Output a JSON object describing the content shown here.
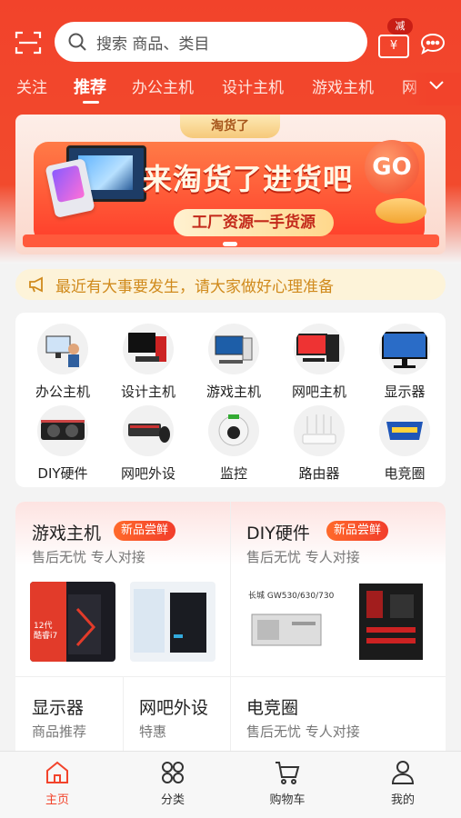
{
  "colors": {
    "brand": "#f2432b",
    "notice_text": "#d08a1c",
    "badge": "#f23d2b"
  },
  "search": {
    "placeholder": "搜索 商品、类目"
  },
  "header": {
    "coupon_badge": "减",
    "coupon_symbol": "¥"
  },
  "tabs": [
    {
      "label": "关注"
    },
    {
      "label": "推荐",
      "active": true
    },
    {
      "label": "办公主机"
    },
    {
      "label": "设计主机"
    },
    {
      "label": "游戏主机"
    },
    {
      "label": "网"
    }
  ],
  "banner": {
    "tag": "淘货了",
    "title": "来淘货了进货吧",
    "subtitle": "工厂资源一手货源",
    "go": "GO"
  },
  "notice": {
    "text": "最近有大事要发生，请大家做好心理准备"
  },
  "categories": [
    {
      "label": "办公主机",
      "icon": "office-pc-icon"
    },
    {
      "label": "设计主机",
      "icon": "design-pc-icon"
    },
    {
      "label": "游戏主机",
      "icon": "gaming-pc-icon"
    },
    {
      "label": "网吧主机",
      "icon": "netcafe-pc-icon"
    },
    {
      "label": "显示器",
      "icon": "monitor-icon"
    },
    {
      "label": "DIY硬件",
      "icon": "gpu-icon"
    },
    {
      "label": "网吧外设",
      "icon": "peripheral-icon"
    },
    {
      "label": "监控",
      "icon": "camera-icon"
    },
    {
      "label": "路由器",
      "icon": "router-icon"
    },
    {
      "label": "电竞圈",
      "icon": "esports-icon"
    }
  ],
  "sections": {
    "gaming": {
      "title": "游戏主机",
      "badge": "新品尝鲜",
      "sub": "售后无忧 专人对接"
    },
    "diy": {
      "title": "DIY硬件",
      "badge": "新品尝鲜",
      "sub": "售后无忧 专人对接"
    },
    "monitor": {
      "title": "显示器",
      "sub": "商品推荐"
    },
    "peripheral": {
      "title": "网吧外设",
      "sub": "特惠"
    },
    "esports": {
      "title": "电竞圈",
      "sub": "售后无忧 专人对接"
    }
  },
  "products": {
    "gaming_1_text": "12代 酷睿i7",
    "psu_text": "长城 GW530/630/730"
  },
  "bottom_nav": [
    {
      "label": "主页",
      "icon": "home-icon",
      "active": true
    },
    {
      "label": "分类",
      "icon": "category-icon"
    },
    {
      "label": "购物车",
      "icon": "cart-icon"
    },
    {
      "label": "我的",
      "icon": "profile-icon"
    }
  ]
}
